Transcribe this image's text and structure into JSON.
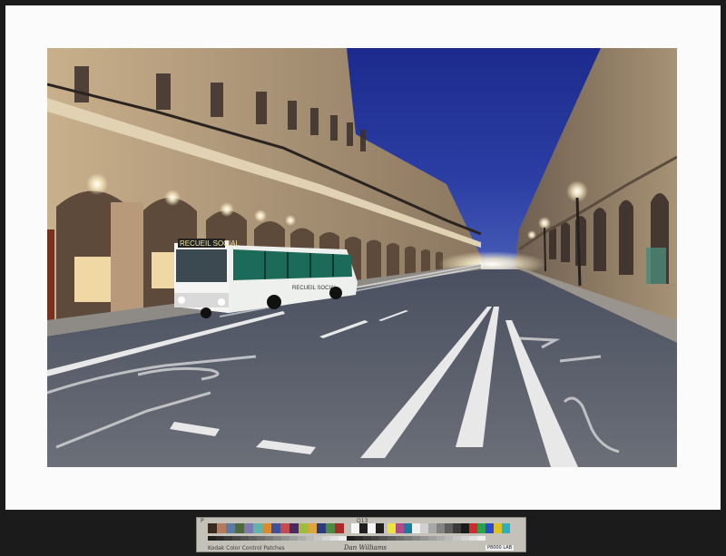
{
  "scene": {
    "bus_destination_sign": "RECUEIL SOCIAL",
    "bus_side_text": "RECUEIL SOCIAL"
  },
  "colors": {
    "mat": "#fbfbfb",
    "frame": "#1b1b1b",
    "sky": "#27358f",
    "facade": "#b59e80"
  },
  "color_target": {
    "header_left": "P",
    "header_mid": "Q13",
    "footer_left": "Kodak Color Control Patches",
    "signature": "Dan Williams",
    "code": "P8000 LAB"
  }
}
